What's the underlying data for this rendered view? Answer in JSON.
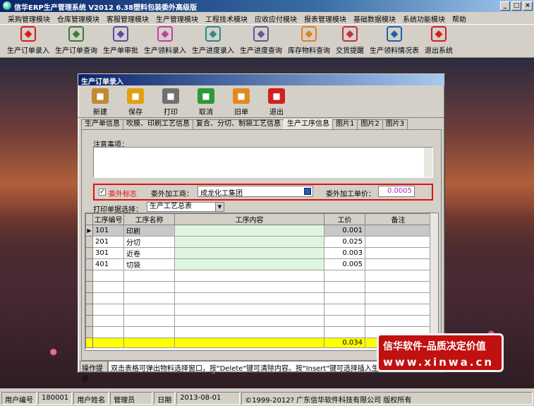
{
  "app": {
    "title": "信华ERP生产管理系统  V2012  6.38塑料包装委外高级版"
  },
  "window_buttons": [
    "_",
    "□",
    "×"
  ],
  "menu": [
    "采购管理模块",
    "仓库管理模块",
    "客服管理模块",
    "生产管理模块",
    "工程技术模块",
    "应收应付模块",
    "报表管理模块",
    "基础数据模块",
    "系统功能模块",
    "帮助"
  ],
  "toolbar": [
    {
      "label": "生产订单录入",
      "icon": "order-entry-icon",
      "color": "#d02020"
    },
    {
      "label": "生产订单查询",
      "icon": "order-query-icon",
      "color": "#3a7a3a"
    },
    {
      "label": "生产单审批",
      "icon": "approve-icon",
      "color": "#5a4aa8"
    },
    {
      "label": "生产领料录入",
      "icon": "material-issue-icon",
      "color": "#c040a0"
    },
    {
      "label": "生产进度录入",
      "icon": "progress-entry-icon",
      "color": "#2a8a8a"
    },
    {
      "label": "生产进度查询",
      "icon": "progress-query-icon",
      "color": "#5a5a9a"
    },
    {
      "label": "库存物料查询",
      "icon": "inventory-icon",
      "color": "#e08020"
    },
    {
      "label": "交货提醒",
      "icon": "delivery-icon",
      "color": "#c03040"
    },
    {
      "label": "生产领料情况表",
      "icon": "material-report-icon",
      "color": "#2060b0"
    },
    {
      "label": "退出系统",
      "icon": "exit-icon",
      "color": "#d02020"
    }
  ],
  "child": {
    "title": "生产订单录入",
    "buttons": [
      {
        "label": "新建",
        "icon": "new-icon",
        "color": "#c08a30"
      },
      {
        "label": "保存",
        "icon": "save-icon",
        "color": "#e0a010"
      },
      {
        "label": "打印",
        "icon": "print-icon",
        "color": "#707070"
      },
      {
        "label": "取消",
        "icon": "cancel-icon",
        "color": "#2a9a3a"
      },
      {
        "label": "旧单",
        "icon": "old-order-icon",
        "color": "#e08a20"
      },
      {
        "label": "退出",
        "icon": "exit-icon",
        "color": "#d02020"
      }
    ],
    "tabs": [
      "生产单信息",
      "吹膜、印刷工艺信息",
      "复合、分切、制袋工艺信息",
      "生产工序信息",
      "图片1",
      "图片2",
      "图片3"
    ],
    "active_tab": 3,
    "notes_label": "注意事项：",
    "outsource": {
      "checkbox_label": "委外标志",
      "checked": true,
      "vendor_label": "委外加工商：",
      "vendor_value": "成龙化工集团",
      "price_label": "委外加工单价：",
      "price_value": "0.0005"
    },
    "print": {
      "label": "打印单据选择：",
      "value": "生产工艺总表"
    },
    "grid": {
      "headers": [
        "工序编号",
        "工序名称",
        "工序内容",
        "工价",
        "备注"
      ],
      "rows": [
        {
          "code": "101",
          "name": "印刷",
          "content": "",
          "price": "0.001",
          "remark": ""
        },
        {
          "code": "201",
          "name": "分切",
          "content": "",
          "price": "0.025",
          "remark": ""
        },
        {
          "code": "301",
          "name": "近卷",
          "content": "",
          "price": "0.003",
          "remark": ""
        },
        {
          "code": "401",
          "name": "切袋",
          "content": "",
          "price": "0.005",
          "remark": ""
        }
      ],
      "total": "0.034"
    },
    "op_hint": {
      "label": "操作提示",
      "text": "双击表格可弹出物料选择窗口，按\"Delete\"键可清除内容。按\"Insert\"键可选择插入生"
    }
  },
  "promo": {
    "line1": "信华软件-品质决定价值",
    "line2": "www.xinwa.cn"
  },
  "statusbar": {
    "user_code_label": "用户编号",
    "user_code": "180001",
    "user_name_label": "用户姓名",
    "user_name": "管理员",
    "date_label": "日期",
    "date": "2013-08-01",
    "copyright": "©1999-2012?  广东信华软件科技有限公司   版权所有"
  }
}
